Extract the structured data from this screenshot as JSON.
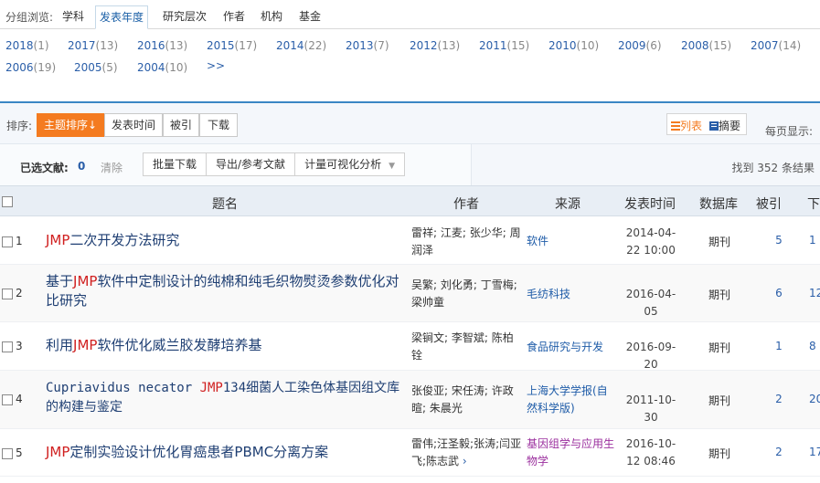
{
  "group_bar": {
    "label": "分组浏览:",
    "tabs": [
      {
        "label": "学科"
      },
      {
        "label": "发表年度"
      },
      {
        "label": "研究层次"
      },
      {
        "label": "作者"
      },
      {
        "label": "机构"
      },
      {
        "label": "基金"
      }
    ],
    "active_tab": "发表年度"
  },
  "years": [
    {
      "year": "2018",
      "count": "(1)"
    },
    {
      "year": "2017",
      "count": "(13)"
    },
    {
      "year": "2016",
      "count": "(13)"
    },
    {
      "year": "2015",
      "count": "(17)"
    },
    {
      "year": "2014",
      "count": "(22)"
    },
    {
      "year": "2013",
      "count": "(7)"
    },
    {
      "year": "2012",
      "count": "(13)"
    },
    {
      "year": "2011",
      "count": "(15)"
    },
    {
      "year": "2010",
      "count": "(10)"
    },
    {
      "year": "2009",
      "count": "(6)"
    },
    {
      "year": "2008",
      "count": "(15)"
    },
    {
      "year": "2007",
      "count": "(14)"
    },
    {
      "year": "2006",
      "count": "(19)"
    },
    {
      "year": "2005",
      "count": "(5)"
    },
    {
      "year": "2004",
      "count": "(10)"
    }
  ],
  "years_more": ">>",
  "sort_bar": {
    "label": "排序:",
    "options": [
      {
        "label": "主题排序",
        "arrow": "↓"
      },
      {
        "label": "发表时间"
      },
      {
        "label": "被引"
      },
      {
        "label": "下载"
      }
    ],
    "view_list": "列表",
    "view_abstract": "摘要",
    "per_page": "每页显示:"
  },
  "selection_bar": {
    "label": "已选文献:",
    "count": "0",
    "clear": "清除",
    "batch_download": "批量下载",
    "export": "导出/参考文献",
    "visual_analysis": "计量可视化分析",
    "found": "找到 352 条结果"
  },
  "table": {
    "headers": {
      "title": "题名",
      "author": "作者",
      "source": "来源",
      "date": "发表时间",
      "database": "数据库",
      "cited": "被引",
      "download": "下"
    },
    "rows": [
      {
        "num": "1",
        "title_kw": "JMP",
        "title_rest": "二次开发方法研究",
        "authors": "雷祥; 江麦; 张少华; 周润泽",
        "source": "软件",
        "date": "2014-04-22 10:00",
        "database": "期刊",
        "cited": "5",
        "download": "1"
      },
      {
        "num": "2",
        "title_pre": "基于",
        "title_kw": "JMP",
        "title_rest": "软件中定制设计的纯棉和纯毛织物熨烫参数优化对比研究",
        "authors": "吴繁; 刘化勇; 丁雪梅; 梁帅童",
        "source": "毛纺科技",
        "date": "2016-04-05",
        "database": "期刊",
        "cited": "6",
        "download": "12"
      },
      {
        "num": "3",
        "title_pre": "利用",
        "title_kw": "JMP",
        "title_rest": "软件优化威兰胶发酵培养基",
        "authors": "梁锏文; 李智斌; 陈柏铨",
        "source": "食品研究与开发",
        "date": "2016-09-20",
        "database": "期刊",
        "cited": "1",
        "download": "8"
      },
      {
        "num": "4",
        "title_pre": "Cupriavidus necator ",
        "title_kw": "JMP",
        "title_rest": "134细菌人工染色体基因组文库的构建与鉴定",
        "authors": "张俊亚; 宋任涛; 许政暄; 朱晨光",
        "source": "上海大学学报(自然科学版)",
        "date": "2011-10-30",
        "database": "期刊",
        "cited": "2",
        "download": "20"
      },
      {
        "num": "5",
        "title_kw": "JMP",
        "title_rest": "定制实验设计优化胃癌患者PBMC分离方案",
        "authors": "雷伟;汪圣毅;张涛;闫亚飞;陈志武",
        "more": "›",
        "source": "基因组学与应用生物学",
        "date": "2016-10-12 08:46",
        "database": "期刊",
        "cited": "2",
        "download": "17"
      }
    ]
  },
  "colors": {
    "accent_orange": "#f47b20",
    "link_blue": "#2a5ea8",
    "keyword_red": "#d02020",
    "rule_blue": "#3a86c4"
  }
}
